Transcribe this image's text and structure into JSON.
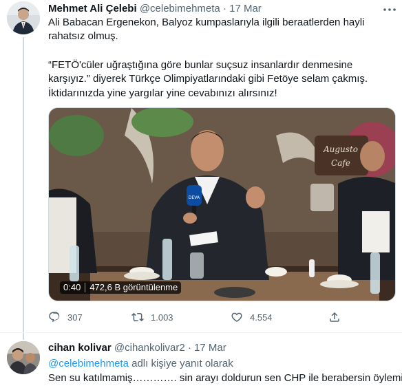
{
  "main_tweet": {
    "author_name": "Mehmet Ali Çelebi",
    "author_handle": "@celebimehmeta",
    "dot": "·",
    "date": "17 Mar",
    "more_icon": "more-dots-icon",
    "paragraphs": [
      "Ali Babacan Ergenekon, Balyoz kumpaslarıyla ilgili beraatlerden hayli rahatsız olmuş.",
      "“FETÖ'cüler uğraştığına göre bunlar suçsuz insanlardır denmesine karşıyız.” diyerek Türkçe Olimpiyatlarındaki gibi Fetöye selam çakmış.",
      "İktidarınızda yine yargılar yine cevabınızı alırsınız!"
    ],
    "media": {
      "video_time": "0:40",
      "view_count": "472,6 B görüntülenme",
      "cafe_sign": "Augusto Cafe",
      "mic_label": "DEVA"
    },
    "actions": {
      "reply_count": "307",
      "retweet_count": "1.003",
      "like_count": "4.554",
      "reply_icon": "reply-icon",
      "retweet_icon": "retweet-icon",
      "like_icon": "heart-icon",
      "share_icon": "share-icon"
    }
  },
  "reply_tweet": {
    "author_name": "cihan kolivar",
    "author_handle": "@cihankolivar2",
    "dot": "·",
    "date": "17 Mar",
    "replying_handle": "@celebimehmeta",
    "replying_suffix": "adlı kişiye yanıt olarak",
    "text": "Sen su katılmamiş…………. sin arayı doldurun sen CHP ile berabersin öylemi"
  },
  "colors": {
    "link": "#1d9bf0",
    "secondary_text": "#536471",
    "primary_text": "#0f1419",
    "divider": "#eff3f4"
  }
}
